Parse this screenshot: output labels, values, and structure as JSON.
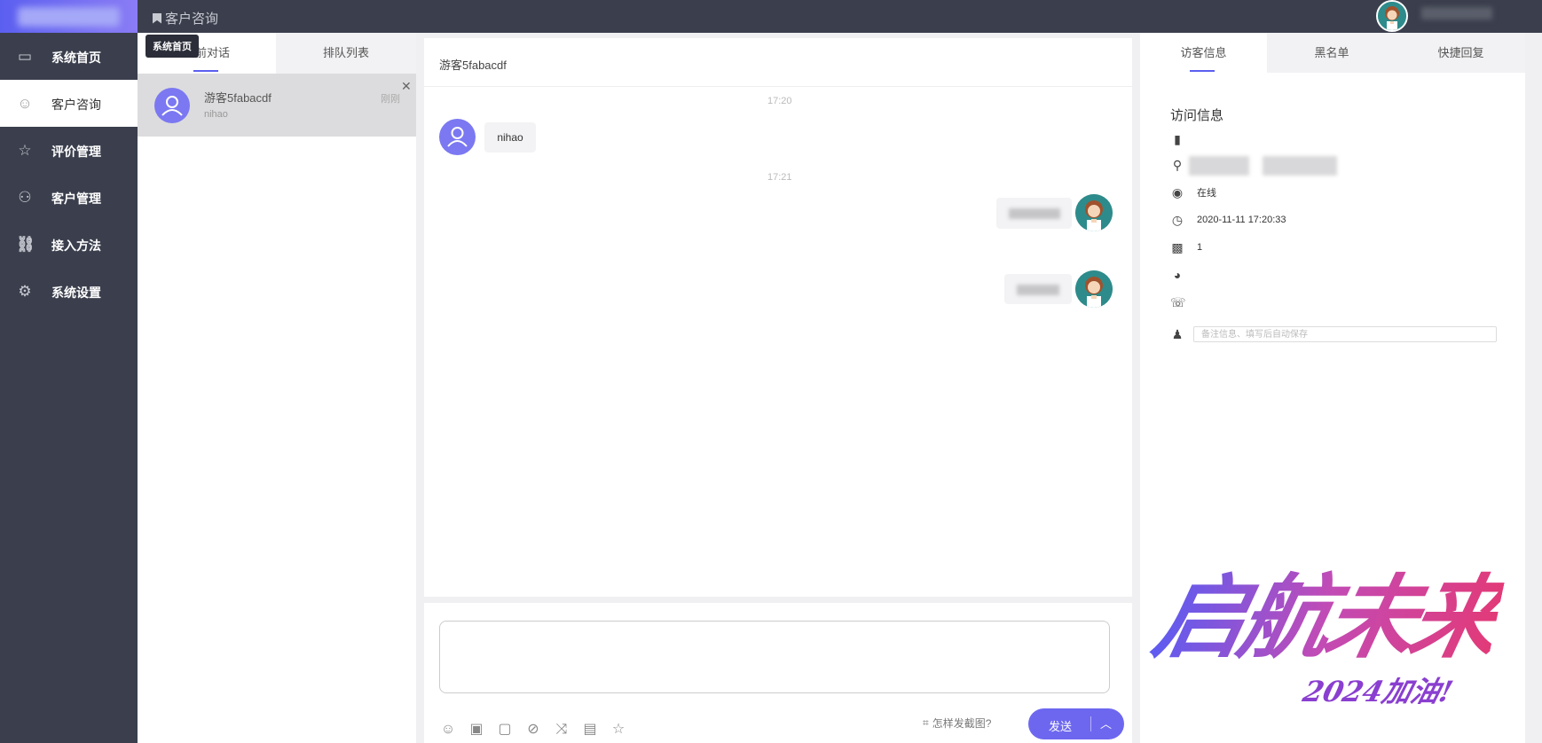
{
  "header": {
    "page_title": "客户咨询"
  },
  "sidebar": {
    "items": [
      {
        "label": "系统首页",
        "icon": "window-icon"
      },
      {
        "label": "客户咨询",
        "icon": "smile-icon"
      },
      {
        "label": "评价管理",
        "icon": "star-icon"
      },
      {
        "label": "客户管理",
        "icon": "user-icon"
      },
      {
        "label": "接入方法",
        "icon": "link-icon"
      },
      {
        "label": "系统设置",
        "icon": "gear-icon"
      }
    ],
    "active_index": 1
  },
  "tooltip": {
    "text": "系统首页"
  },
  "conversation_list": {
    "tabs": [
      "当前对话",
      "排队列表"
    ],
    "items": [
      {
        "name": "游客5fabacdf",
        "last_message": "nihao",
        "time": "刚刚"
      }
    ]
  },
  "chat": {
    "title": "游客5fabacdf",
    "time_labels": [
      "17:20",
      "17:21"
    ],
    "visitor_message": "nihao",
    "screenshot_hint": "怎样发截图?",
    "send_label": "发送"
  },
  "right_panel": {
    "tabs": [
      "访客信息",
      "黑名单",
      "快捷回复"
    ],
    "section_title": "访问信息",
    "status": "在线",
    "visit_time": "2020-11-11 17:20:33",
    "visit_count": "1",
    "note_placeholder": "备注信息、填写后自动保存"
  },
  "watermark": {
    "main": "启航未来",
    "sub": "2024加油!"
  },
  "colors": {
    "accent": "#6d67f0",
    "sidebar_bg": "#3b3f4d"
  }
}
